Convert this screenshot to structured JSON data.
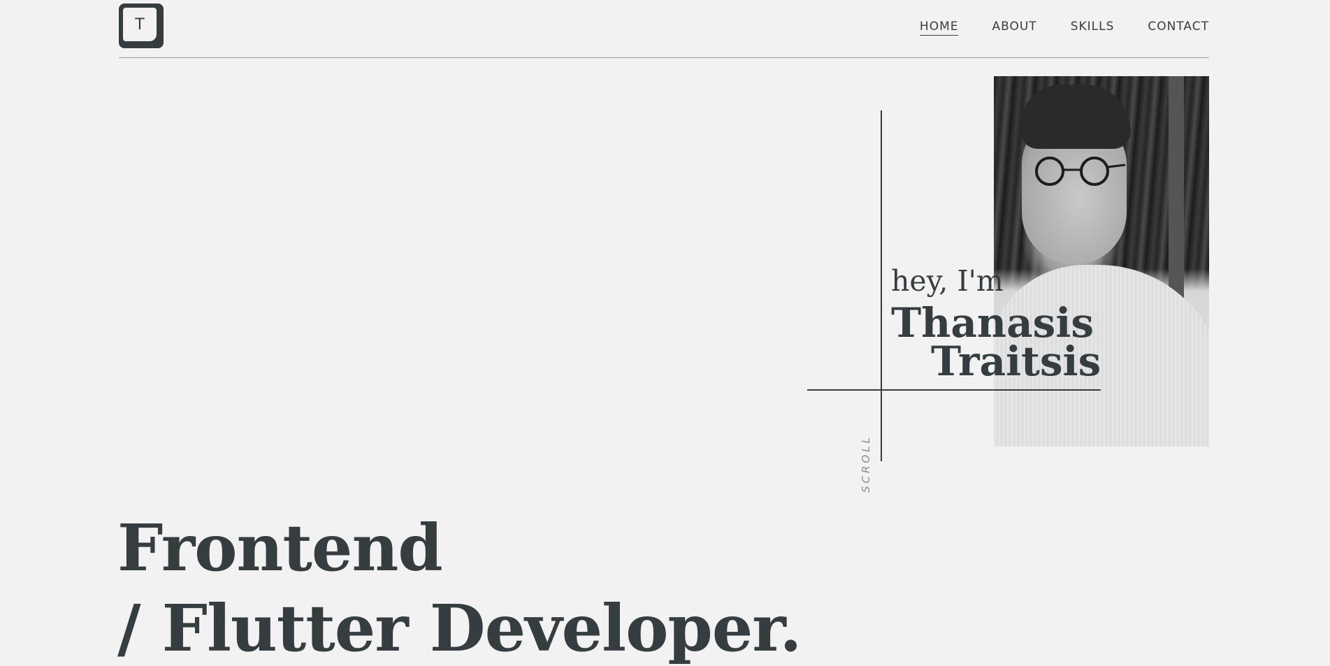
{
  "header": {
    "logo_letter": "T",
    "nav": [
      {
        "label": "HOME",
        "active": true
      },
      {
        "label": "ABOUT",
        "active": false
      },
      {
        "label": "SKILLS",
        "active": false
      },
      {
        "label": "CONTACT",
        "active": false
      }
    ]
  },
  "hero": {
    "greeting": "hey, I'm",
    "first_name": "Thanasis",
    "last_name": "Traitsis",
    "scroll_label": "SCROLL",
    "headline_line1": "Frontend",
    "headline_line2": "/ Flutter Developer."
  },
  "colors": {
    "background": "#f2f2f2",
    "text": "#363d40",
    "muted": "#8b8b8b",
    "divider": "#9a9a9a"
  }
}
